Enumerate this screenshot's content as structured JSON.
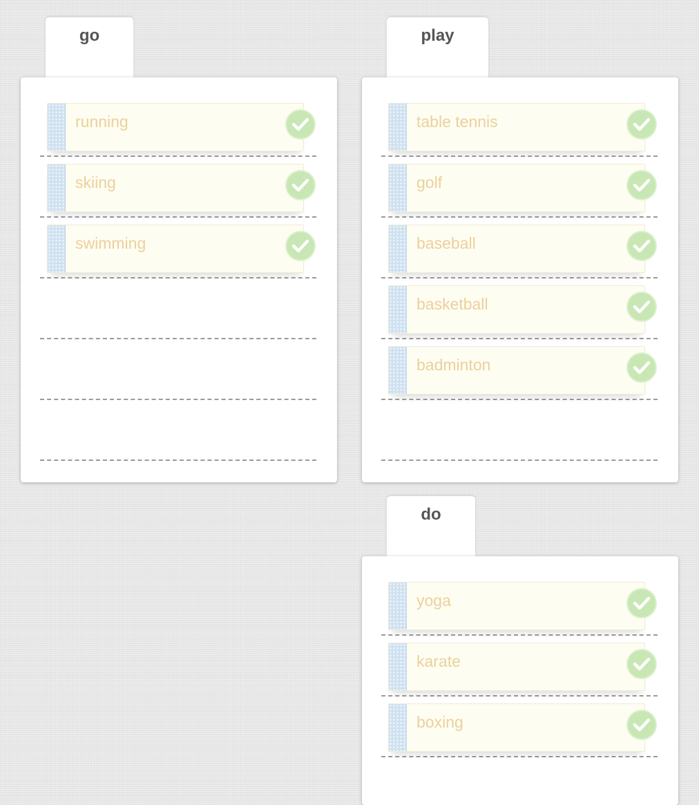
{
  "groups": [
    {
      "title": "go",
      "items": [
        "running",
        "skiing",
        "swimming"
      ]
    },
    {
      "title": "play",
      "items": [
        "table tennis",
        "golf",
        "baseball",
        "basketball",
        "badminton"
      ]
    },
    {
      "title": "do",
      "items": [
        "yoga",
        "karate",
        "boxing"
      ]
    }
  ],
  "colors": {
    "check": "#bfe3a8",
    "item_text": "#e8c98a",
    "grip": "#c7dcef"
  },
  "icons": {
    "item_status": "check-icon",
    "drag_handle": "grip-icon"
  }
}
